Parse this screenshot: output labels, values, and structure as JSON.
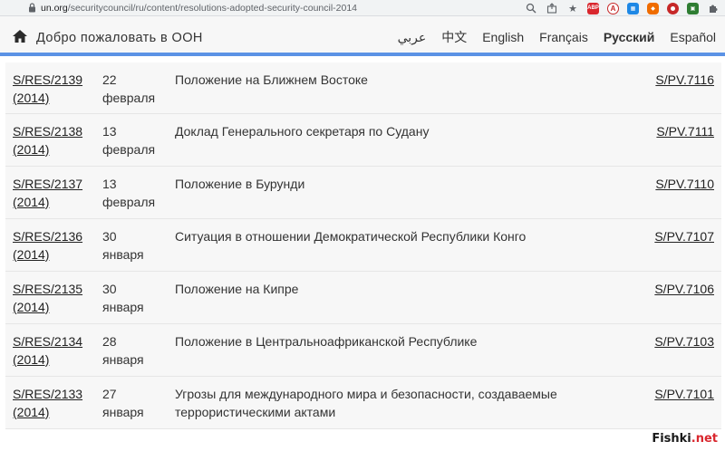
{
  "browser": {
    "url_host": "un.org",
    "url_path": "/securitycouncil/ru/content/resolutions-adopted-security-council-2014"
  },
  "header": {
    "welcome": "Добро пожаловать в ООН",
    "languages": [
      "عربي",
      "中文",
      "English",
      "Français",
      "Русский",
      "Español"
    ],
    "active_language": "Русский",
    "accent_color": "#5b92e5"
  },
  "rows": [
    {
      "res": "S/RES/2139",
      "year": "(2014)",
      "day": "22",
      "month": "февраля",
      "title": "Положение на Ближнем Востоке",
      "title2": "",
      "pv": "S/PV.7116"
    },
    {
      "res": "S/RES/2138",
      "year": "(2014)",
      "day": "13",
      "month": "февраля",
      "title": "Доклад Генерального секретаря по Судану",
      "title2": "",
      "pv": "S/PV.7111"
    },
    {
      "res": "S/RES/2137",
      "year": "(2014)",
      "day": "13",
      "month": "февраля",
      "title": "Положение в Бурунди",
      "title2": "",
      "pv": "S/PV.7110"
    },
    {
      "res": "S/RES/2136",
      "year": "(2014)",
      "day": "30",
      "month": "января",
      "title": "Ситуация в отношении Демократической Республики Конго",
      "title2": "",
      "pv": "S/PV.7107"
    },
    {
      "res": "S/RES/2135",
      "year": "(2014)",
      "day": "30",
      "month": "января",
      "title": "Положение на Кипре",
      "title2": "",
      "pv": "S/PV.7106"
    },
    {
      "res": "S/RES/2134",
      "year": "(2014)",
      "day": "28",
      "month": "января",
      "title": "Положение в Центральноафриканской Республике",
      "title2": "",
      "pv": "S/PV.7103"
    },
    {
      "res": "S/RES/2133",
      "year": "(2014)",
      "day": "27",
      "month": "января",
      "title": "Угрозы для международного мира и безопасности, создаваемые",
      "title2": "террористическими актами",
      "pv": "S/PV.7101"
    }
  ],
  "watermark": {
    "main": "Fishki",
    "suffix": ".net"
  }
}
